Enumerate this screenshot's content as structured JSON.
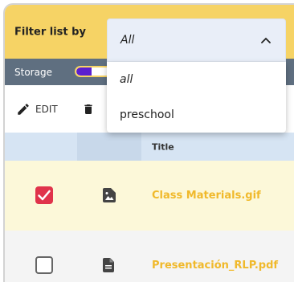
{
  "filter": {
    "label": "Filter list by",
    "selected": "All",
    "options": [
      "all",
      "preschool"
    ]
  },
  "storage": {
    "label": "Storage",
    "used_fraction": 0.08
  },
  "toolbar": {
    "edit_label": "EDIT",
    "delete_label": ""
  },
  "table": {
    "columns": [
      "",
      "",
      "Title"
    ],
    "rows": [
      {
        "checked": true,
        "icon": "image-file-icon",
        "title": "Class Materials.gif"
      },
      {
        "checked": false,
        "icon": "document-file-icon",
        "title": "Presentación_RLP.pdf"
      }
    ]
  },
  "colors": {
    "filter_bar": "#f6d365",
    "storage_bar": "#5f6f80",
    "storage_fill": "#5b1fcf",
    "checkbox_checked": "#e0334b",
    "file_name": "#f0b92b",
    "selected_row": "#fcf8d9"
  }
}
